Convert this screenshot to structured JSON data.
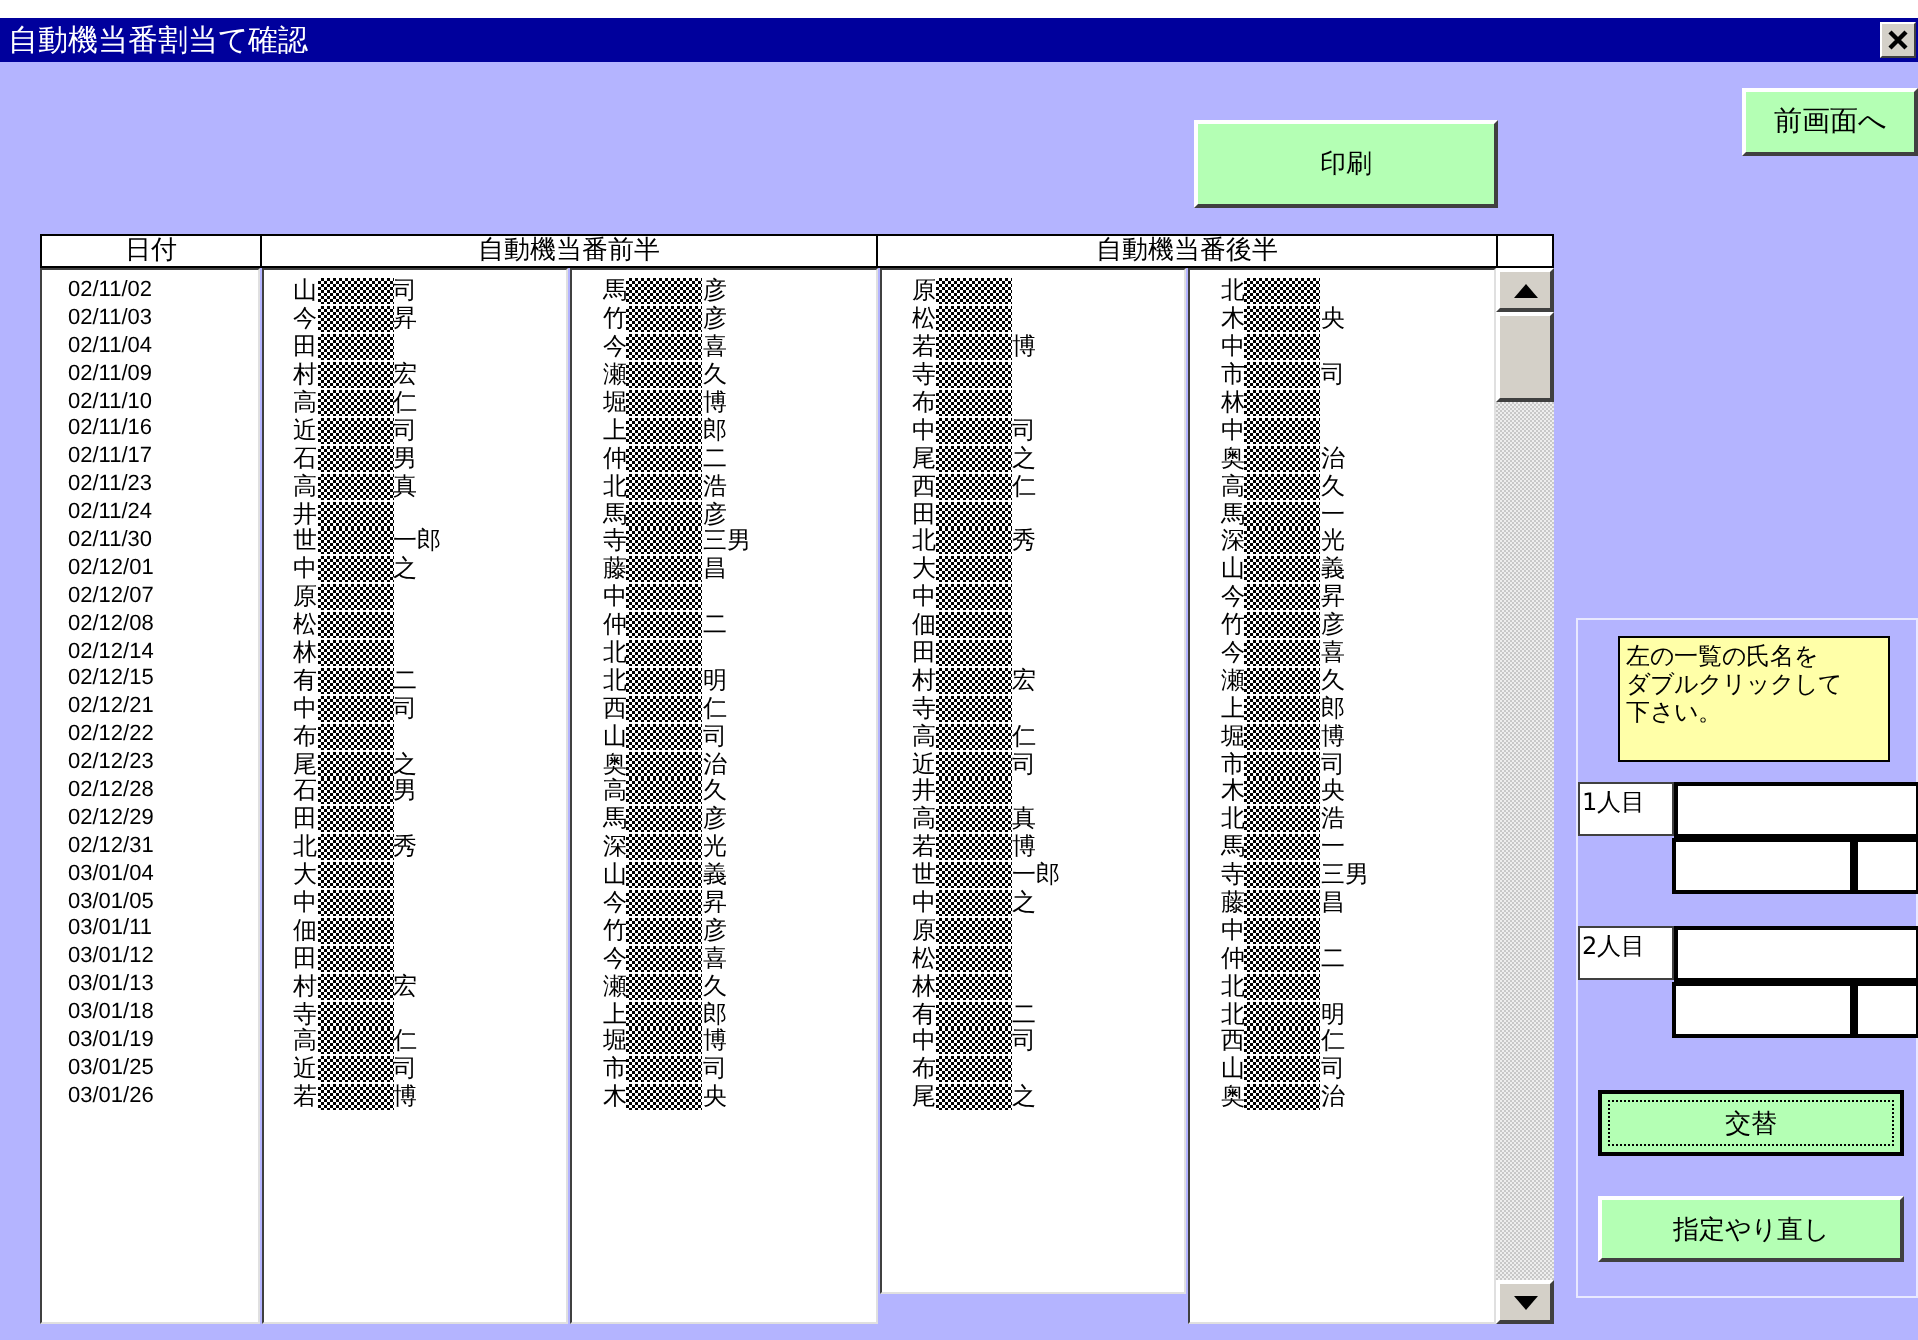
{
  "window": {
    "title": "自動機当番割当て確認"
  },
  "back_button": {
    "label": "前画面へ"
  },
  "print_button": {
    "label": "印刷"
  },
  "table": {
    "columns": [
      {
        "label": "日付"
      },
      {
        "label": "自動機当番前半"
      },
      {
        "label": "自動機当番後半"
      }
    ],
    "rows": [
      {
        "date": "02/11/02",
        "names": [
          {
            "head": "山",
            "tail": "司"
          },
          {
            "head": "馬",
            "tail": "彦"
          },
          {
            "head": "原"
          },
          {
            "head": "北"
          }
        ]
      },
      {
        "date": "02/11/03",
        "names": [
          {
            "head": "今",
            "tail": "昇"
          },
          {
            "head": "竹",
            "tail": "彦"
          },
          {
            "head": "松"
          },
          {
            "head": "木",
            "tail": "央"
          }
        ]
      },
      {
        "date": "02/11/04",
        "names": [
          {
            "head": "田"
          },
          {
            "head": "今",
            "tail": "喜"
          },
          {
            "head": "若",
            "tail": "博"
          },
          {
            "head": "中"
          }
        ]
      },
      {
        "date": "02/11/09",
        "names": [
          {
            "head": "村",
            "tail": "宏"
          },
          {
            "head": "瀬",
            "tail": "久"
          },
          {
            "head": "寺"
          },
          {
            "head": "市",
            "tail": "司"
          }
        ]
      },
      {
        "date": "02/11/10",
        "names": [
          {
            "head": "高",
            "tail": "仁"
          },
          {
            "head": "堀",
            "tail": "博"
          },
          {
            "head": "布"
          },
          {
            "head": "林"
          }
        ]
      },
      {
        "date": "02/11/16",
        "names": [
          {
            "head": "近",
            "tail": "司"
          },
          {
            "head": "上",
            "tail": "郎"
          },
          {
            "head": "中",
            "tail": "司"
          },
          {
            "head": "中"
          }
        ]
      },
      {
        "date": "02/11/17",
        "names": [
          {
            "head": "石",
            "tail": "男"
          },
          {
            "head": "仲",
            "tail": "二"
          },
          {
            "head": "尾",
            "tail": "之"
          },
          {
            "head": "奥",
            "tail": "治"
          }
        ]
      },
      {
        "date": "02/11/23",
        "names": [
          {
            "head": "高",
            "tail": "真"
          },
          {
            "head": "北",
            "tail": "浩"
          },
          {
            "head": "西",
            "tail": "仁"
          },
          {
            "head": "高",
            "tail": "久"
          }
        ]
      },
      {
        "date": "02/11/24",
        "names": [
          {
            "head": "井"
          },
          {
            "head": "馬",
            "tail": "彦"
          },
          {
            "head": "田"
          },
          {
            "head": "馬",
            "tail": "一"
          }
        ]
      },
      {
        "date": "02/11/30",
        "names": [
          {
            "head": "世",
            "tail": "一郎"
          },
          {
            "head": "寺",
            "tail": "三男"
          },
          {
            "head": "北",
            "tail": "秀"
          },
          {
            "head": "深",
            "tail": "光"
          }
        ]
      },
      {
        "date": "02/12/01",
        "names": [
          {
            "head": "中",
            "tail": "之"
          },
          {
            "head": "藤",
            "tail": "昌"
          },
          {
            "head": "大"
          },
          {
            "head": "山",
            "tail": "義"
          }
        ]
      },
      {
        "date": "02/12/07",
        "names": [
          {
            "head": "原"
          },
          {
            "head": "中"
          },
          {
            "head": "中"
          },
          {
            "head": "今",
            "tail": "昇"
          }
        ]
      },
      {
        "date": "02/12/08",
        "names": [
          {
            "head": "松"
          },
          {
            "head": "仲",
            "tail": "二"
          },
          {
            "head": "佃"
          },
          {
            "head": "竹",
            "tail": "彦"
          }
        ]
      },
      {
        "date": "02/12/14",
        "names": [
          {
            "head": "林"
          },
          {
            "head": "北"
          },
          {
            "head": "田"
          },
          {
            "head": "今",
            "tail": "喜"
          }
        ]
      },
      {
        "date": "02/12/15",
        "names": [
          {
            "head": "有",
            "tail": "二"
          },
          {
            "head": "北",
            "tail": "明"
          },
          {
            "head": "村",
            "tail": "宏"
          },
          {
            "head": "瀬",
            "tail": "久"
          }
        ]
      },
      {
        "date": "02/12/21",
        "names": [
          {
            "head": "中",
            "tail": "司"
          },
          {
            "head": "西",
            "tail": "仁"
          },
          {
            "head": "寺"
          },
          {
            "head": "上",
            "tail": "郎"
          }
        ]
      },
      {
        "date": "02/12/22",
        "names": [
          {
            "head": "布"
          },
          {
            "head": "山",
            "tail": "司"
          },
          {
            "head": "高",
            "tail": "仁"
          },
          {
            "head": "堀",
            "tail": "博"
          }
        ]
      },
      {
        "date": "02/12/23",
        "names": [
          {
            "head": "尾",
            "tail": "之"
          },
          {
            "head": "奥",
            "tail": "治"
          },
          {
            "head": "近",
            "tail": "司"
          },
          {
            "head": "市",
            "tail": "司"
          }
        ]
      },
      {
        "date": "02/12/28",
        "names": [
          {
            "head": "石",
            "tail": "男"
          },
          {
            "head": "高",
            "tail": "久"
          },
          {
            "head": "井"
          },
          {
            "head": "木",
            "tail": "央"
          }
        ]
      },
      {
        "date": "02/12/29",
        "names": [
          {
            "head": "田"
          },
          {
            "head": "馬",
            "tail": "彦"
          },
          {
            "head": "高",
            "tail": "真"
          },
          {
            "head": "北",
            "tail": "浩"
          }
        ]
      },
      {
        "date": "02/12/31",
        "names": [
          {
            "head": "北",
            "tail": "秀"
          },
          {
            "head": "深",
            "tail": "光"
          },
          {
            "head": "若",
            "tail": "博"
          },
          {
            "head": "馬",
            "tail": "一"
          }
        ]
      },
      {
        "date": "03/01/04",
        "names": [
          {
            "head": "大"
          },
          {
            "head": "山",
            "tail": "義"
          },
          {
            "head": "世",
            "tail": "一郎"
          },
          {
            "head": "寺",
            "tail": "三男"
          }
        ]
      },
      {
        "date": "03/01/05",
        "names": [
          {
            "head": "中"
          },
          {
            "head": "今",
            "tail": "昇"
          },
          {
            "head": "中",
            "tail": "之"
          },
          {
            "head": "藤",
            "tail": "昌"
          }
        ]
      },
      {
        "date": "03/01/11",
        "names": [
          {
            "head": "佃"
          },
          {
            "head": "竹",
            "tail": "彦"
          },
          {
            "head": "原"
          },
          {
            "head": "中"
          }
        ]
      },
      {
        "date": "03/01/12",
        "names": [
          {
            "head": "田"
          },
          {
            "head": "今",
            "tail": "喜"
          },
          {
            "head": "松"
          },
          {
            "head": "仲",
            "tail": "二"
          }
        ]
      },
      {
        "date": "03/01/13",
        "names": [
          {
            "head": "村",
            "tail": "宏"
          },
          {
            "head": "瀬",
            "tail": "久"
          },
          {
            "head": "林"
          },
          {
            "head": "北"
          }
        ]
      },
      {
        "date": "03/01/18",
        "names": [
          {
            "head": "寺"
          },
          {
            "head": "上",
            "tail": "郎"
          },
          {
            "head": "有",
            "tail": "二"
          },
          {
            "head": "北",
            "tail": "明"
          }
        ]
      },
      {
        "date": "03/01/19",
        "names": [
          {
            "head": "高",
            "tail": "仁"
          },
          {
            "head": "堀",
            "tail": "博"
          },
          {
            "head": "中",
            "tail": "司"
          },
          {
            "head": "西",
            "tail": "仁"
          }
        ]
      },
      {
        "date": "03/01/25",
        "names": [
          {
            "head": "近",
            "tail": "司"
          },
          {
            "head": "市",
            "tail": "司"
          },
          {
            "head": "布"
          },
          {
            "head": "山",
            "tail": "司"
          }
        ]
      },
      {
        "date": "03/01/26",
        "names": [
          {
            "head": "若",
            "tail": "博"
          },
          {
            "head": "木",
            "tail": "央"
          },
          {
            "head": "尾",
            "tail": "之"
          },
          {
            "head": "奥",
            "tail": "治"
          }
        ]
      }
    ]
  },
  "panel": {
    "note_lines": [
      "左の一覧の氏名を",
      "ダブルクリックして",
      "下さい。"
    ],
    "slots": [
      {
        "label": "1人目"
      },
      {
        "label": "2人目"
      }
    ],
    "swap_button": {
      "label": "交替",
      "focused": true
    },
    "reset_button": {
      "label": "指定やり直し",
      "focused": false
    }
  }
}
